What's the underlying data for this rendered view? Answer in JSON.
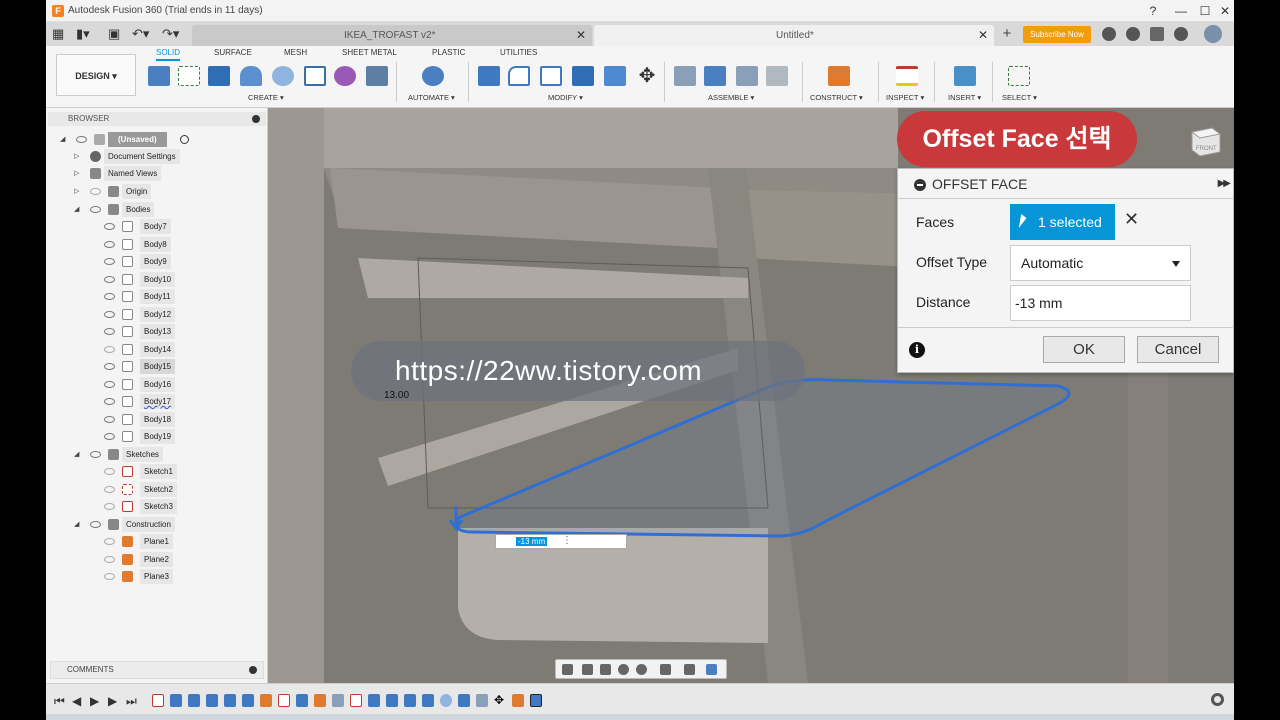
{
  "app": {
    "title": "Autodesk Fusion 360 (Trial ends in 11 days)",
    "logo_letter": "F"
  },
  "tabs": {
    "inactive_label": "IKEA_TROFAST v2*",
    "active_label": "Untitled*",
    "subscribe_label": "Subscribe Now"
  },
  "ribbon": {
    "design_label": "DESIGN ▾",
    "tabs": [
      "SOLID",
      "SURFACE",
      "MESH",
      "SHEET METAL",
      "PLASTIC",
      "UTILITIES"
    ],
    "groups": [
      "CREATE ▾",
      "AUTOMATE ▾",
      "MODIFY ▾",
      "ASSEMBLE ▾",
      "CONSTRUCT ▾",
      "INSPECT ▾",
      "INSERT ▾",
      "SELECT ▾"
    ]
  },
  "browser": {
    "header": "BROWSER",
    "root": "(Unsaved)",
    "document_settings": "Document Settings",
    "named_views": "Named Views",
    "origin": "Origin",
    "bodies_folder": "Bodies",
    "bodies": [
      "Body7",
      "Body8",
      "Body9",
      "Body10",
      "Body11",
      "Body12",
      "Body13",
      "Body14",
      "Body15",
      "Body16",
      "Body17",
      "Body18",
      "Body19"
    ],
    "sketches_folder": "Sketches",
    "sketches": [
      "Sketch1",
      "Sketch2",
      "Sketch3"
    ],
    "construction_folder": "Construction",
    "planes": [
      "Plane1",
      "Plane2",
      "Plane3"
    ],
    "comments": "COMMENTS"
  },
  "banner": {
    "text": "Offset Face 선택"
  },
  "offset_face": {
    "title": "OFFSET FACE",
    "faces_label": "Faces",
    "faces_value": "1 selected",
    "offset_type_label": "Offset Type",
    "offset_type_value": "Automatic",
    "distance_label": "Distance",
    "distance_value": "-13 mm",
    "ok_label": "OK",
    "cancel_label": "Cancel"
  },
  "viewport": {
    "watermark": "https://22ww.tistory.com",
    "dimension_label": "13.00",
    "inline_distance": "-13 mm",
    "viewcube_label": "FRONT"
  },
  "colors": {
    "accent": "#0696d7",
    "banner": "#c9383a",
    "subscribe": "#f39c12",
    "brand": "#f58220"
  }
}
